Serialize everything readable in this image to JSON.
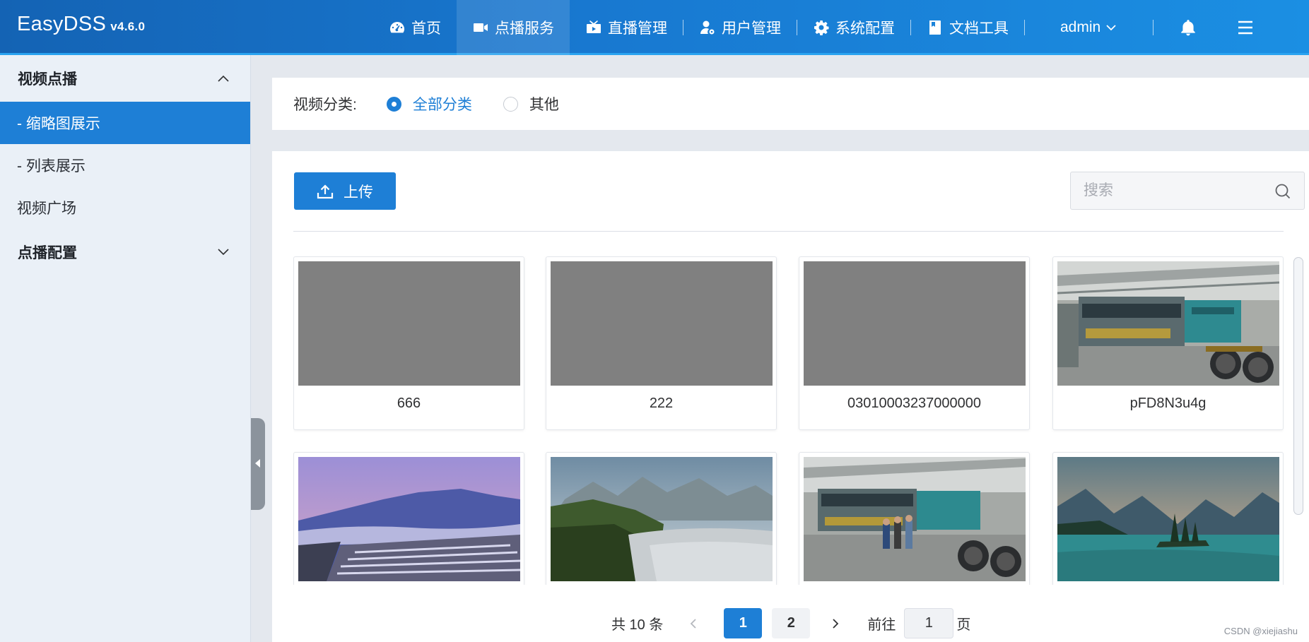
{
  "header": {
    "brand": "EasyDSS",
    "version": "v4.6.0",
    "nav": [
      {
        "label": "首页",
        "icon": "dashboard-icon"
      },
      {
        "label": "点播服务",
        "icon": "video-camera-icon",
        "active": true
      },
      {
        "label": "直播管理",
        "icon": "live-tv-icon"
      },
      {
        "label": "用户管理",
        "icon": "user-gear-icon"
      },
      {
        "label": "系统配置",
        "icon": "gear-icon"
      },
      {
        "label": "文档工具",
        "icon": "book-icon"
      }
    ],
    "user": "admin"
  },
  "sidebar": {
    "group_vod": "视频点播",
    "items": [
      {
        "label": "- 缩略图展示",
        "active": true
      },
      {
        "label": "- 列表展示"
      },
      {
        "label": "视频广场"
      }
    ],
    "group_config": "点播配置"
  },
  "filter": {
    "label": "视频分类:",
    "options": [
      {
        "label": "全部分类",
        "checked": true
      },
      {
        "label": "其他",
        "checked": false
      }
    ]
  },
  "toolbar": {
    "upload_label": "上传",
    "search_placeholder": "搜索"
  },
  "videos": [
    {
      "title": "666",
      "thumb": "gray"
    },
    {
      "title": "222",
      "thumb": "gray"
    },
    {
      "title": "03010003237000000",
      "thumb": "gray"
    },
    {
      "title": "pFD8N3u4g",
      "thumb": "factory"
    },
    {
      "title": "",
      "thumb": "terraces"
    },
    {
      "title": "",
      "thumb": "mountains-fog"
    },
    {
      "title": "",
      "thumb": "factory-workers"
    },
    {
      "title": "",
      "thumb": "lake"
    }
  ],
  "pagination": {
    "total": "共 10 条",
    "pages": [
      "1",
      "2"
    ],
    "current": "1",
    "goto_label": "前往",
    "goto_value": "1",
    "page_suffix": "页"
  },
  "watermark": "CSDN @xiejiashu",
  "colors": {
    "primary": "#1e7fd6",
    "header": "#1878d0"
  }
}
